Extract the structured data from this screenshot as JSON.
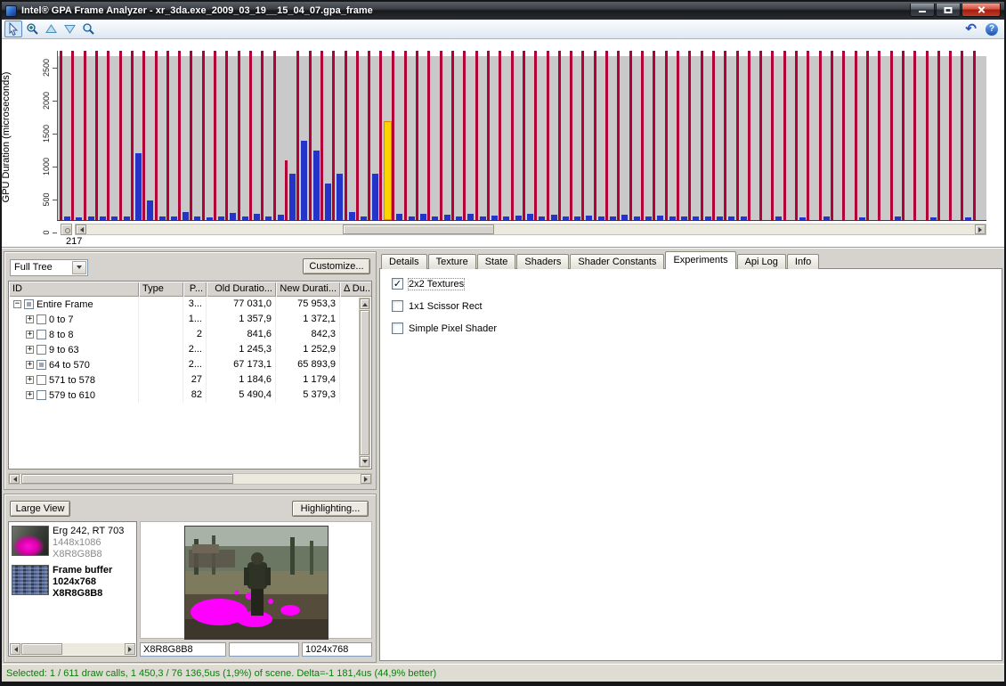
{
  "window": {
    "title": "Intel® GPA Frame Analyzer - xr_3da.exe_2009_03_19__15_04_07.gpa_frame"
  },
  "toolbar": {
    "icons": [
      "select-tool",
      "zoom-in",
      "scroll-up",
      "scroll-down",
      "zoom-region"
    ],
    "right_icons": [
      "undo",
      "help"
    ]
  },
  "chart": {
    "ylabel": "GPU Duration (microseconds)",
    "x_first_label": "217",
    "chart_data": {
      "type": "bar",
      "title": "",
      "ylabel": "GPU Duration (microseconds)",
      "ylim": [
        0,
        2500
      ],
      "yticks": [
        0,
        500,
        1000,
        1500,
        2000,
        2500
      ],
      "selected_index": 27,
      "selected_value": 1500,
      "selected_color": "#ffd300",
      "series": [
        {
          "name": "old duration",
          "color": "#b10136",
          "values": [
            2600,
            2600,
            2600,
            2600,
            2600,
            2600,
            2600,
            2600,
            2600,
            2600,
            2600,
            2600,
            2600,
            2600,
            2600,
            2600,
            2600,
            2600,
            2600,
            900,
            2600,
            2600,
            2600,
            2600,
            2600,
            2600,
            2600,
            2600,
            2600,
            2600,
            2600,
            2600,
            2600,
            2600,
            2600,
            2600,
            2600,
            2600,
            2600,
            2600,
            2600,
            2600,
            2600,
            2600,
            2600,
            2600,
            2600,
            2600,
            2600,
            2600,
            2600,
            2600,
            2600,
            2600,
            2600,
            2600,
            2600,
            2600,
            2600,
            2600,
            2600,
            2600,
            2600,
            2600,
            2600,
            2600,
            2600,
            2600,
            2600,
            2600,
            2600,
            2600,
            2600,
            2600,
            2600,
            2600,
            2600,
            2600
          ]
        },
        {
          "name": "new duration",
          "color": "#2433c8",
          "values": [
            55,
            45,
            60,
            50,
            60,
            55,
            1020,
            300,
            60,
            50,
            120,
            55,
            45,
            55,
            110,
            50,
            95,
            55,
            85,
            700,
            1200,
            1050,
            550,
            700,
            120,
            60,
            700,
            1500,
            100,
            55,
            100,
            60,
            80,
            55,
            90,
            60,
            70,
            55,
            65,
            90,
            55,
            80,
            60,
            55,
            70,
            55,
            60,
            80,
            55,
            60,
            70,
            55,
            60,
            55,
            60,
            50,
            55,
            60,
            0,
            0,
            50,
            0,
            45,
            0,
            50,
            0,
            0,
            45,
            0,
            0,
            50,
            0,
            0,
            45,
            0,
            0,
            40,
            0
          ]
        }
      ]
    }
  },
  "tree": {
    "view_mode": "Full Tree",
    "customize_label": "Customize...",
    "columns": [
      "ID",
      "Type",
      "P...",
      "Old Duratio...",
      "New Durati...",
      "Δ Du..."
    ],
    "rows": [
      {
        "id": "Entire Frame",
        "type": "",
        "p": "3...",
        "old": "77 031,0",
        "new": "75 953,3",
        "delta": "",
        "expander": "minus",
        "checkbox": "mixed",
        "level": 0
      },
      {
        "id": "0 to 7",
        "type": "",
        "p": "1...",
        "old": "1 357,9",
        "new": "1 372,1",
        "delta": "",
        "expander": "plus",
        "checkbox": "unchecked",
        "level": 1
      },
      {
        "id": "8 to 8",
        "type": "",
        "p": "2",
        "old": "841,6",
        "new": "842,3",
        "delta": "",
        "expander": "plus",
        "checkbox": "unchecked",
        "level": 1
      },
      {
        "id": "9 to 63",
        "type": "",
        "p": "2...",
        "old": "1 245,3",
        "new": "1 252,9",
        "delta": "",
        "expander": "plus",
        "checkbox": "unchecked",
        "level": 1
      },
      {
        "id": "64 to 570",
        "type": "",
        "p": "2...",
        "old": "67 173,1",
        "new": "65 893,9",
        "delta": "",
        "expander": "plus",
        "checkbox": "mixed",
        "level": 1
      },
      {
        "id": "571 to 578",
        "type": "",
        "p": "27",
        "old": "1 184,6",
        "new": "1 179,4",
        "delta": "",
        "expander": "plus",
        "checkbox": "unchecked",
        "level": 1
      },
      {
        "id": "579 to 610",
        "type": "",
        "p": "82",
        "old": "5 490,4",
        "new": "5 379,3",
        "delta": "",
        "expander": "plus",
        "checkbox": "unchecked",
        "level": 1
      }
    ]
  },
  "preview": {
    "large_view_label": "Large View",
    "highlighting_label": "Highlighting...",
    "thumbnails": [
      {
        "title": "Erg 242, RT 703",
        "resolution": "1448x1086",
        "format": "X8R8G8B8",
        "selected": false
      },
      {
        "title": "Frame buffer",
        "resolution": "1024x768",
        "format": "X8R8G8B8",
        "selected": true
      }
    ],
    "fields": {
      "format": "X8R8G8B8",
      "middle": "",
      "resolution": "1024x768"
    }
  },
  "right_panel": {
    "tabs": [
      "Details",
      "Texture",
      "State",
      "Shaders",
      "Shader Constants",
      "Experiments",
      "Api Log",
      "Info"
    ],
    "active_tab": "Experiments",
    "experiments": [
      {
        "label": "2x2 Textures",
        "checked": true,
        "focused": true
      },
      {
        "label": "1x1 Scissor Rect",
        "checked": false,
        "focused": false
      },
      {
        "label": "Simple Pixel Shader",
        "checked": false,
        "focused": false
      }
    ]
  },
  "status": {
    "text": "Selected: 1 / 611 draw calls, 1 450,3 / 76 136,5us (1,9%) of scene.  Delta=-1 181,4us (44,9% better)"
  }
}
